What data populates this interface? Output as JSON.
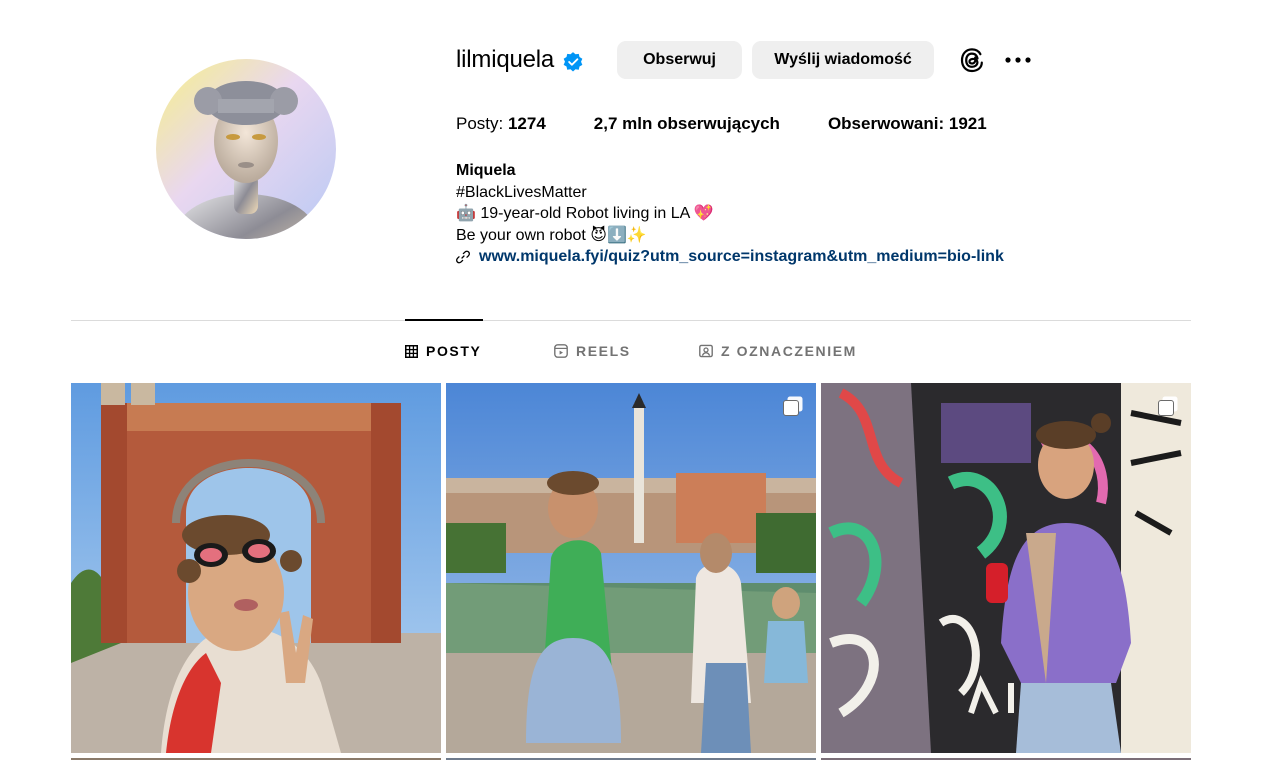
{
  "profile": {
    "username": "lilmiquela",
    "follow_label": "Obserwuj",
    "message_label": "Wyślij wiadomość",
    "stats": {
      "posts_label": "Posty: ",
      "posts_value": "1274",
      "followers_value": "2,7 mln",
      "followers_label": " obserwujących",
      "following_label": "Obserwowani: ",
      "following_value": "1921"
    },
    "bio": {
      "name": "Miquela",
      "line1": "#BlackLivesMatter",
      "line2": "🤖 19-year-old Robot living in LA 💖",
      "line3": "Be your own robot 😈⬇️✨",
      "link": "www.miquela.fyi/quiz?utm_source=instagram&utm_medium=bio-link"
    }
  },
  "tabs": [
    {
      "label": "POSTY",
      "icon": "grid-icon",
      "active": true
    },
    {
      "label": "REELS",
      "icon": "reels-icon",
      "active": false
    },
    {
      "label": "Z OZNACZENIEM",
      "icon": "tagged-icon",
      "active": false
    }
  ],
  "posts": [
    {
      "description_icon": "single-photo",
      "multi": false
    },
    {
      "description_icon": "carousel-icon",
      "multi": true
    },
    {
      "description_icon": "carousel-icon",
      "multi": true
    }
  ],
  "colors": {
    "verified": "#0095f6",
    "link": "#00376b",
    "button_bg": "#efefef",
    "divider": "#dbdbdb",
    "tab_inactive": "#737373"
  }
}
